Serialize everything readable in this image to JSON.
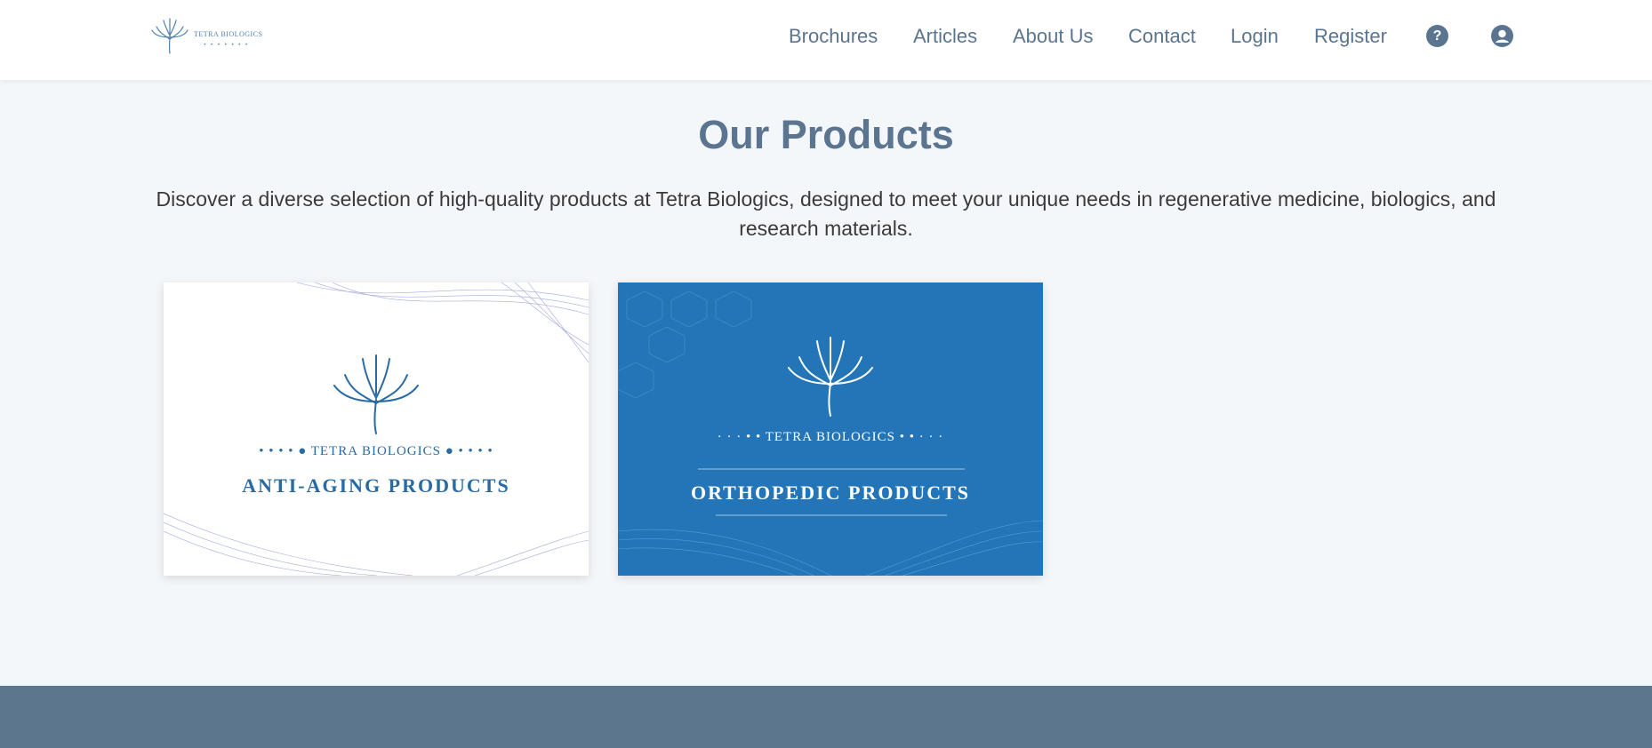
{
  "brand": {
    "logo_text": "TETRA BIOLOGICS",
    "logo_dots": "• • • • • • •"
  },
  "nav": {
    "links": [
      "Brochures",
      "Articles",
      "About Us",
      "Contact",
      "Login",
      "Register"
    ],
    "help_icon": "question-circle-icon",
    "user_icon": "user-circle-icon"
  },
  "main": {
    "title": "Our Products",
    "intro": "Discover a diverse selection of high-quality products at Tetra Biologics, designed to meet your unique needs in regenerative medicine, biologics, and research materials."
  },
  "products": [
    {
      "brand_line": "• • • • ● TETRA BIOLOGICS ● • • • •",
      "name": "ANTI-AGING PRODUCTS"
    },
    {
      "brand_line": "· · · • • TETRA BIOLOGICS • • · · ·",
      "name": "ORTHOPEDIC PRODUCTS"
    }
  ],
  "colors": {
    "nav_text": "#5b7590",
    "page_bg": "#f4f7fa",
    "card_blue": "#2475b7",
    "footer": "#5c768d"
  }
}
